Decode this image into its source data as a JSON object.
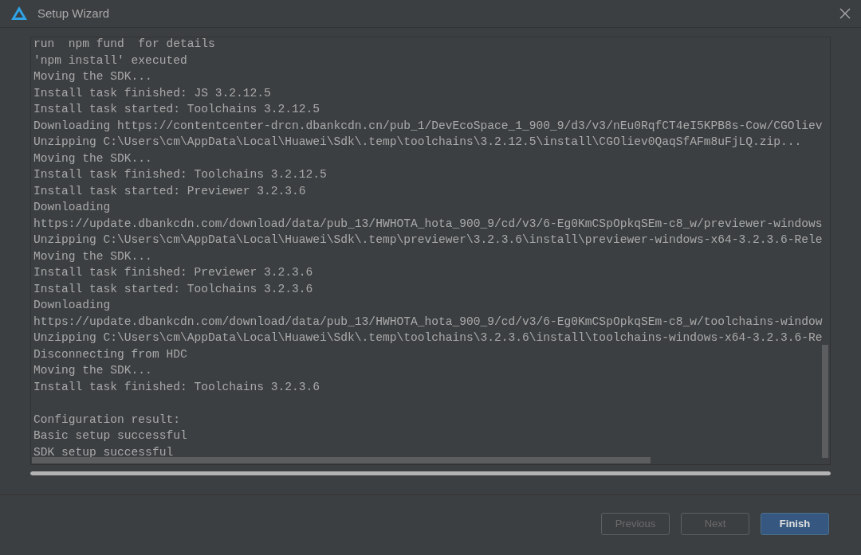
{
  "window": {
    "title": "Setup Wizard"
  },
  "log": {
    "lines": [
      "run  npm fund  for details",
      "'npm install' executed",
      "Moving the SDK...",
      "Install task finished: JS 3.2.12.5",
      "Install task started: Toolchains 3.2.12.5",
      "Downloading https://contentcenter-drcn.dbankcdn.cn/pub_1/DevEcoSpace_1_900_9/d3/v3/nEu0RqfCT4eI5KPB8s-Cow/CGOliev",
      "Unzipping C:\\Users\\cm\\AppData\\Local\\Huawei\\Sdk\\.temp\\toolchains\\3.2.12.5\\install\\CGOliev0QaqSfAFm8uFjLQ.zip...",
      "Moving the SDK...",
      "Install task finished: Toolchains 3.2.12.5",
      "Install task started: Previewer 3.2.3.6",
      "Downloading",
      "https://update.dbankcdn.com/download/data/pub_13/HWHOTA_hota_900_9/cd/v3/6-Eg0KmCSpOpkqSEm-c8_w/previewer-windows",
      "Unzipping C:\\Users\\cm\\AppData\\Local\\Huawei\\Sdk\\.temp\\previewer\\3.2.3.6\\install\\previewer-windows-x64-3.2.3.6-Rele",
      "Moving the SDK...",
      "Install task finished: Previewer 3.2.3.6",
      "Install task started: Toolchains 3.2.3.6",
      "Downloading",
      "https://update.dbankcdn.com/download/data/pub_13/HWHOTA_hota_900_9/cd/v3/6-Eg0KmCSpOpkqSEm-c8_w/toolchains-window",
      "Unzipping C:\\Users\\cm\\AppData\\Local\\Huawei\\Sdk\\.temp\\toolchains\\3.2.3.6\\install\\toolchains-windows-x64-3.2.3.6-Re",
      "Disconnecting from HDC",
      "Moving the SDK...",
      "Install task finished: Toolchains 3.2.3.6"
    ],
    "result_lines": [
      "Configuration result:",
      "Basic setup successful",
      "SDK setup successful"
    ]
  },
  "progress": {
    "level": 1
  },
  "buttons": [
    {
      "label": "Previous",
      "kind": "secondary",
      "disabled": true
    },
    {
      "label": "Next",
      "kind": "secondary",
      "disabled": true
    },
    {
      "label": "Finish",
      "kind": "primary",
      "disabled": false
    }
  ]
}
